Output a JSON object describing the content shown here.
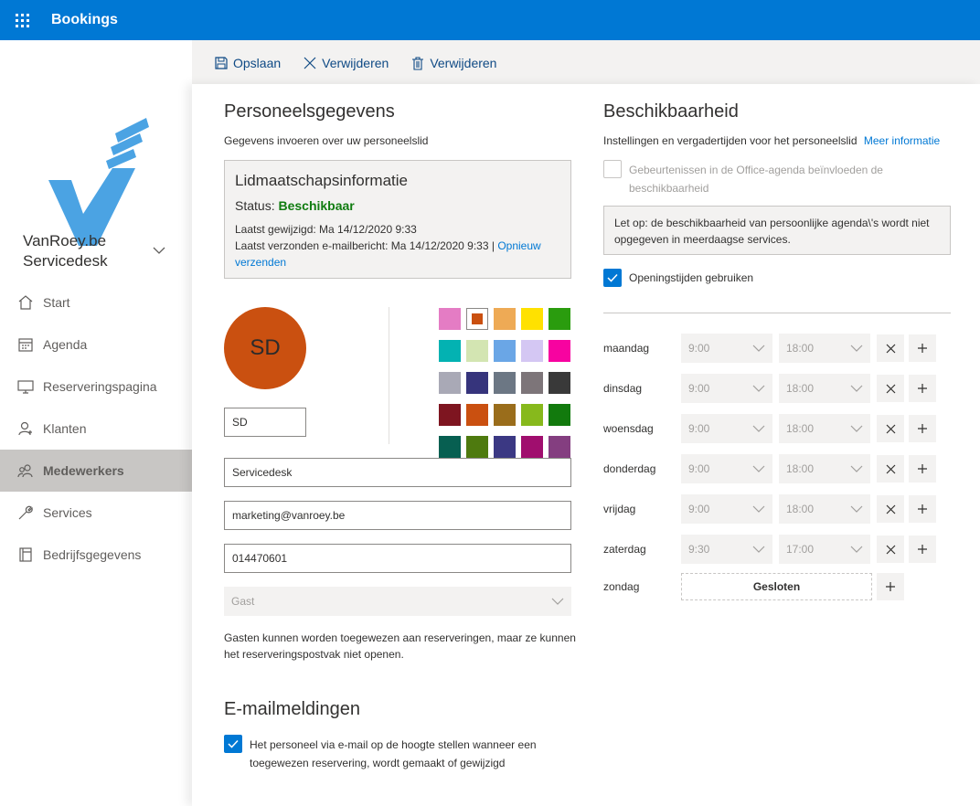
{
  "app": {
    "title": "Bookings"
  },
  "sidebar": {
    "org_name_line1": "VanRoey.be",
    "org_name_line2": "Servicedesk",
    "items": [
      {
        "label": "Start",
        "icon": "home-icon"
      },
      {
        "label": "Agenda",
        "icon": "calendar-icon"
      },
      {
        "label": "Reserveringspagina",
        "icon": "monitor-icon"
      },
      {
        "label": "Klanten",
        "icon": "person-icon"
      },
      {
        "label": "Medewerkers",
        "icon": "people-icon",
        "active": true
      },
      {
        "label": "Services",
        "icon": "wrench-icon"
      },
      {
        "label": "Bedrijfsgegevens",
        "icon": "building-icon"
      }
    ]
  },
  "toolbar": {
    "save_label": "Opslaan",
    "discard_label": "Verwijderen",
    "delete_label": "Verwijderen"
  },
  "staff": {
    "heading": "Personeelsgegevens",
    "subheading": "Gegevens invoeren over uw personeelslid",
    "membership": {
      "title": "Lidmaatschapsinformatie",
      "status_label": "Status:",
      "status_value": "Beschikbaar",
      "last_modified": "Laatst gewijzigd: Ma 14/12/2020 9:33",
      "last_email_prefix": "Laatst verzonden e-mailbericht: Ma 14/12/2020 9:33 |",
      "resend_link": "Opnieuw verzenden"
    },
    "avatar_initials": "SD",
    "initials_value": "SD",
    "name_value": "Servicedesk",
    "email_value": "marketing@vanroey.be",
    "phone_value": "014470601",
    "role_value": "Gast",
    "guest_note": "Gasten kunnen worden toegewezen aan reserveringen, maar ze kunnen het reserveringspostvak niet openen.",
    "selected_color": "#ca5010",
    "palette": [
      "#e47cc4",
      "selected",
      "#eeaa55",
      "#ffe100",
      "#2a9c0e",
      "#03b2b2",
      "#d3e5b2",
      "#6aa6e6",
      "#d4c7f3",
      "#f703a0",
      "#a9a9b6",
      "#36347c",
      "#6c7784",
      "#7d7579",
      "#393939",
      "#7e1520",
      "#ca5010",
      "#9a6d1b",
      "#87b91c",
      "#127a0d",
      "#075f51",
      "#4e7a0f",
      "#3b3883",
      "#a00e6e",
      "#843e80"
    ]
  },
  "email_notifications": {
    "heading": "E-mailmeldingen",
    "checkbox_label_line1": "Het personeel via e-mail op de hoogte stellen wanneer een",
    "checkbox_label_line2": "toegewezen reservering, wordt gemaakt of gewijzigd"
  },
  "availability": {
    "heading": "Beschikbaarheid",
    "subheading": "Instellingen en vergadertijden voor het personeelslid",
    "more_info_link": "Meer informatie",
    "office_cb_line1": "Gebeurtenissen in de Office-agenda beïnvloeden de",
    "office_cb_line2": "beschikbaarheid",
    "warning": "Let op: de beschikbaarheid van persoonlijke agenda\\'s wordt niet opgegeven in meerdaagse services.",
    "business_hours_label": "Openingstijden gebruiken",
    "days": [
      {
        "day": "maandag",
        "start": "9:00",
        "end": "18:00"
      },
      {
        "day": "dinsdag",
        "start": "9:00",
        "end": "18:00"
      },
      {
        "day": "woensdag",
        "start": "9:00",
        "end": "18:00"
      },
      {
        "day": "donderdag",
        "start": "9:00",
        "end": "18:00"
      },
      {
        "day": "vrijdag",
        "start": "9:00",
        "end": "18:00"
      },
      {
        "day": "zaterdag",
        "start": "9:30",
        "end": "17:00"
      }
    ],
    "sunday": {
      "day": "zondag",
      "closed_label": "Gesloten"
    }
  }
}
